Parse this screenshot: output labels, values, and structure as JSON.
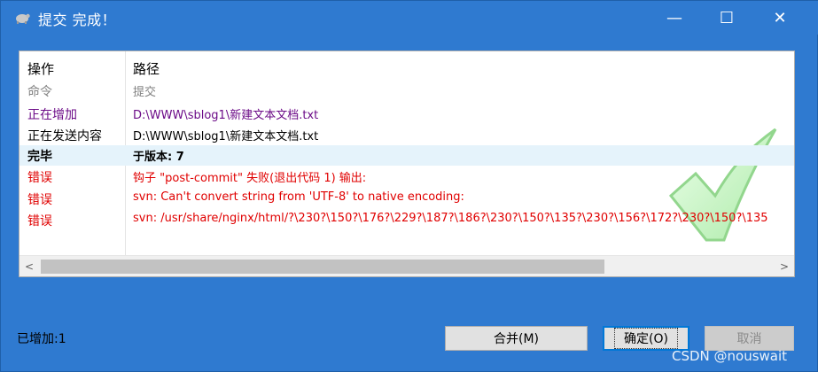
{
  "window": {
    "title": "提交 完成！"
  },
  "titlebar": {
    "min_glyph": "—",
    "max_glyph": "☐",
    "close_glyph": "✕"
  },
  "list": {
    "headers": {
      "action": "操作",
      "path": "路径"
    },
    "rows": [
      {
        "action": "命令",
        "path": "提交",
        "color": "#808080"
      },
      {
        "action": "正在增加",
        "path": "D:\\WWW\\sblog1\\新建文本文档.txt",
        "color": "#6b0a87"
      },
      {
        "action": "正在发送内容",
        "path": "D:\\WWW\\sblog1\\新建文本文档.txt",
        "color": "#000000"
      },
      {
        "action": "完毕",
        "path": "于版本: 7",
        "color": "#000000",
        "bold": true,
        "selected": true
      },
      {
        "action": "错误",
        "path": "钩子 \"post-commit\" 失败(退出代码 1) 输出:",
        "color": "#e00000"
      },
      {
        "action": "错误",
        "path": "svn: Can't convert string from 'UTF-8' to native encoding:",
        "color": "#e00000"
      },
      {
        "action": "错误",
        "path": "svn: /usr/share/nginx/html/?\\230?\\150?\\176?\\229?\\187?\\186?\\230?\\150?\\135?\\230?\\156?\\172?\\230?\\150?\\135",
        "color": "#e00000"
      }
    ]
  },
  "scrollbar": {
    "left_glyph": "<",
    "right_glyph": ">"
  },
  "status": {
    "text": "已增加:1"
  },
  "buttons": {
    "merge": "合并(M)",
    "ok": "确定(O)",
    "cancel": "取消"
  },
  "watermark": {
    "text": "CSDN @nouswait"
  }
}
